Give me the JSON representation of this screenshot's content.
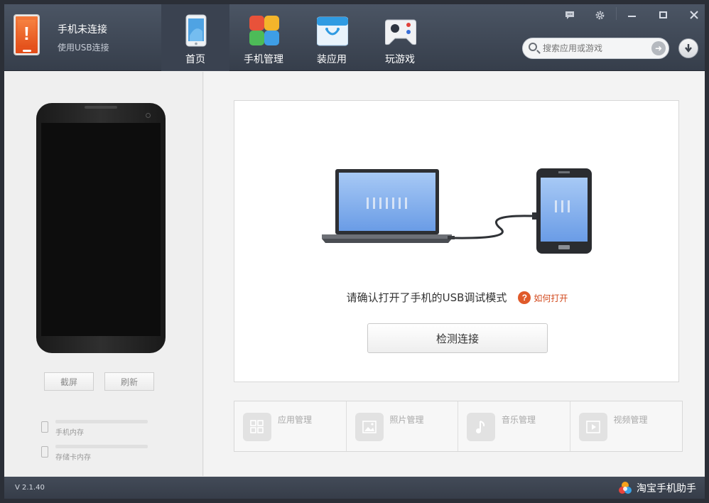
{
  "header": {
    "status_title": "手机未连接",
    "status_subtitle": "使用USB连接",
    "nav": [
      {
        "label": "首页",
        "active": true,
        "icon": "phone-home-icon"
      },
      {
        "label": "手机管理",
        "active": false,
        "icon": "grid-icon"
      },
      {
        "label": "装应用",
        "active": false,
        "icon": "store-bag-icon"
      },
      {
        "label": "玩游戏",
        "active": false,
        "icon": "gamepad-icon"
      }
    ],
    "controls": [
      "feedback-icon",
      "settings-icon",
      "minimize-icon",
      "maximize-icon",
      "close-icon"
    ],
    "search_placeholder": "搜索应用或游戏"
  },
  "left": {
    "screenshot_btn": "截屏",
    "refresh_btn": "刷新",
    "storage": [
      "手机内存",
      "存储卡内存"
    ]
  },
  "main": {
    "hint": "请确认打开了手机的USB调试模式",
    "help_icon_text": "?",
    "help_link": "如何打开",
    "detect_btn": "检测连接",
    "features": [
      "应用管理",
      "照片管理",
      "音乐管理",
      "视频管理"
    ]
  },
  "footer": {
    "version": "V 2.1.40",
    "brand": "淘宝手机助手"
  },
  "colors": {
    "header_dark": "#363e4b",
    "accent_orange": "#e24a16",
    "link_red": "#d24a1e"
  }
}
